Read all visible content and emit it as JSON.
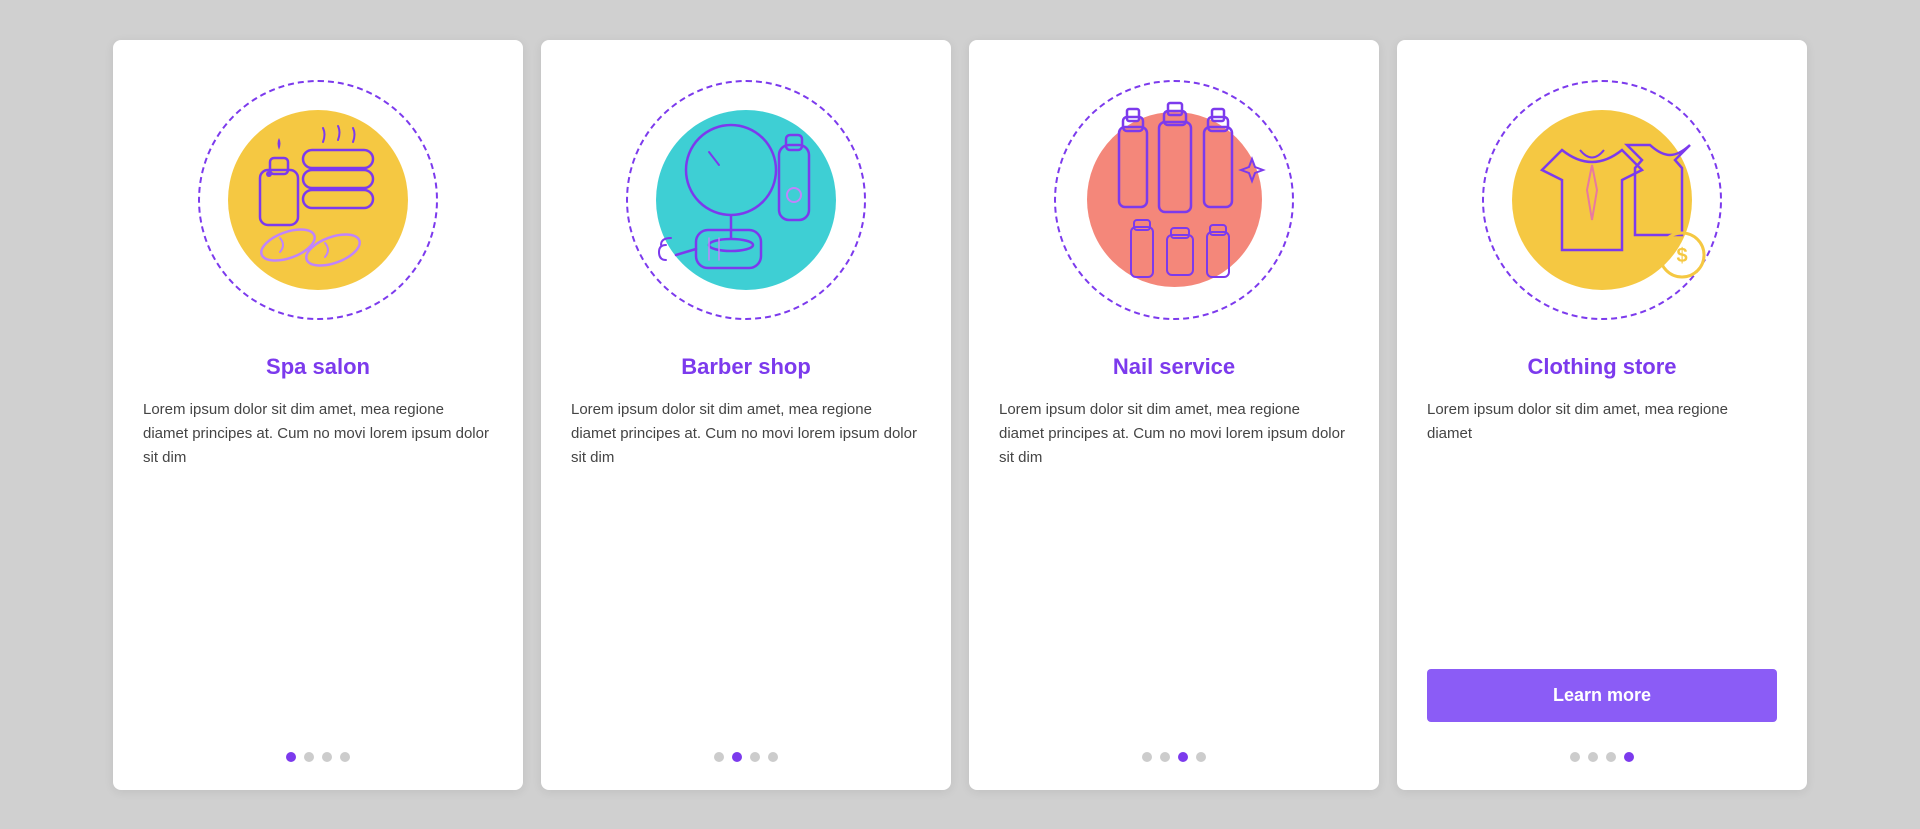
{
  "cards": [
    {
      "id": "spa-salon",
      "title": "Spa salon",
      "text": "Lorem ipsum dolor sit dim amet, mea regione diamet principes at. Cum no movi lorem ipsum dolor sit dim",
      "circle_color": "#f5c842",
      "dots": [
        "active",
        "inactive",
        "inactive",
        "inactive"
      ],
      "show_button": false,
      "button_label": ""
    },
    {
      "id": "barber-shop",
      "title": "Barber shop",
      "text": "Lorem ipsum dolor sit dim amet, mea regione diamet principes at. Cum no movi lorem ipsum dolor sit dim",
      "circle_color": "#3ecfd4",
      "dots": [
        "inactive",
        "active",
        "inactive",
        "inactive"
      ],
      "show_button": false,
      "button_label": ""
    },
    {
      "id": "nail-service",
      "title": "Nail service",
      "text": "Lorem ipsum dolor sit dim amet, mea regione diamet principes at. Cum no movi lorem ipsum dolor sit dim",
      "circle_color": "#f4877a",
      "dots": [
        "inactive",
        "inactive",
        "active",
        "inactive"
      ],
      "show_button": false,
      "button_label": ""
    },
    {
      "id": "clothing-store",
      "title": "Clothing store",
      "text": "Lorem ipsum dolor sit dim amet, mea regione diamet",
      "circle_color": "#f5c842",
      "dots": [
        "inactive",
        "inactive",
        "inactive",
        "active"
      ],
      "show_button": true,
      "button_label": "Learn more"
    }
  ]
}
